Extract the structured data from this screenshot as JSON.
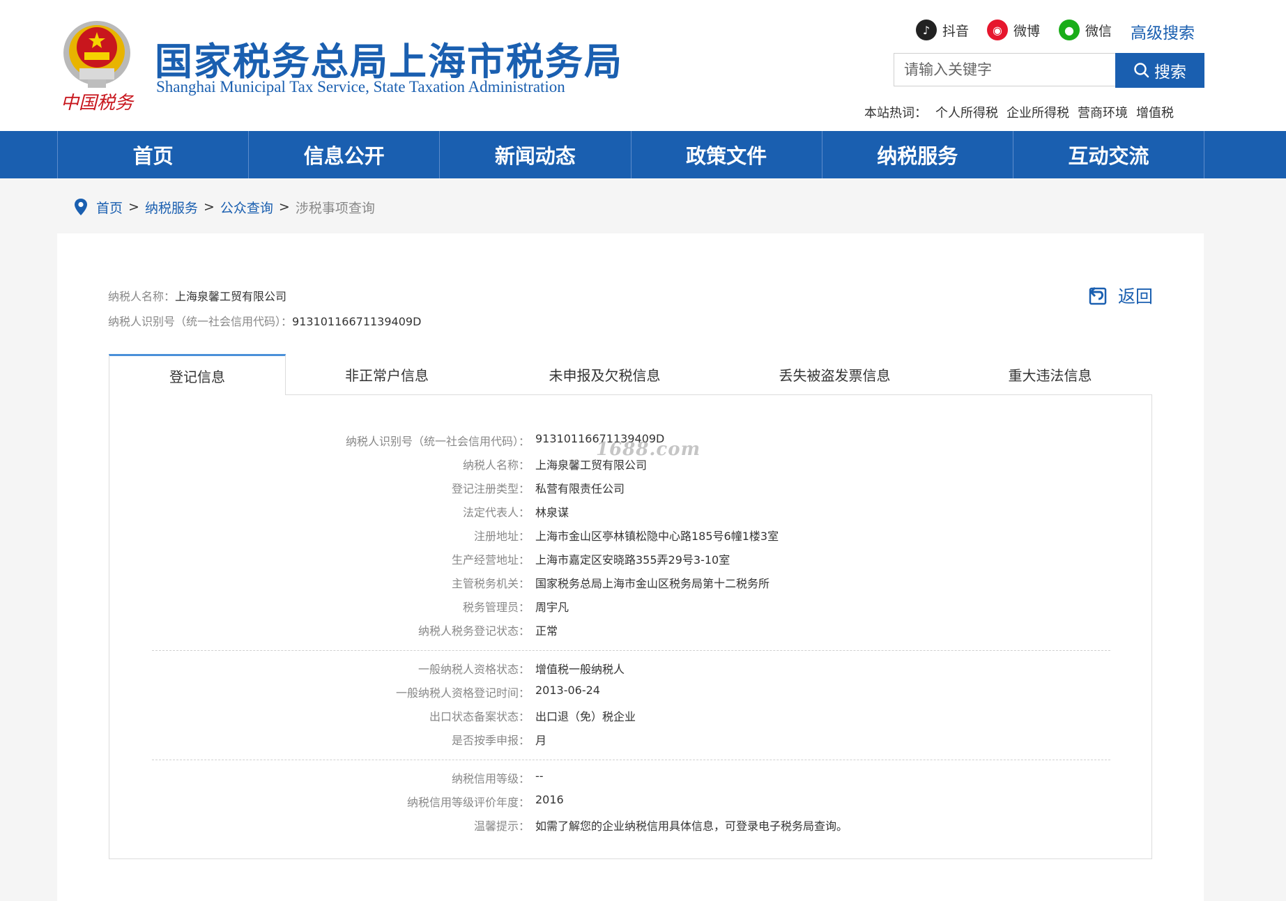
{
  "header": {
    "title_cn": "国家税务总局上海市税务局",
    "title_en": "Shanghai Municipal Tax Service, State Taxation Administration",
    "emblem_caption": "中国税务",
    "social": [
      {
        "name": "douyin",
        "label": "抖音",
        "icon": "douyin-icon",
        "color": "#222222"
      },
      {
        "name": "weibo",
        "label": "微博",
        "icon": "weibo-icon",
        "color": "#e6162d"
      },
      {
        "name": "wechat",
        "label": "微信",
        "icon": "wechat-icon",
        "color": "#1aad19"
      }
    ],
    "advanced_search": "高级搜索",
    "search": {
      "placeholder": "请输入关键字",
      "value": "",
      "button": "搜索"
    },
    "hot": {
      "label": "本站热词：",
      "items": [
        "个人所得税",
        "企业所得税",
        "营商环境",
        "增值税"
      ]
    }
  },
  "nav": [
    "首页",
    "信息公开",
    "新闻动态",
    "政策文件",
    "纳税服务",
    "互动交流"
  ],
  "breadcrumb": {
    "items": [
      "首页",
      "纳税服务",
      "公众查询"
    ],
    "current": "涉税事项查询",
    "sep": ">"
  },
  "taxpayer": {
    "name_label": "纳税人名称：",
    "name": "上海泉馨工贸有限公司",
    "id_label": "纳税人识别号（统一社会信用代码）：",
    "id": "91310116671139409D"
  },
  "back_label": "返回",
  "tabs": [
    "登记信息",
    "非正常户信息",
    "未申报及欠税信息",
    "丢失被盗发票信息",
    "重大违法信息"
  ],
  "details": {
    "group1": [
      {
        "k": "纳税人识别号（统一社会信用代码）：",
        "v": "91310116671139409D"
      },
      {
        "k": "纳税人名称：",
        "v": "上海泉馨工贸有限公司"
      },
      {
        "k": "登记注册类型：",
        "v": "私营有限责任公司"
      },
      {
        "k": "法定代表人：",
        "v": "林泉谋"
      },
      {
        "k": "注册地址：",
        "v": "上海市金山区亭林镇松隐中心路185号6幢1楼3室"
      },
      {
        "k": "生产经营地址：",
        "v": "上海市嘉定区安晓路355弄29号3-10室"
      },
      {
        "k": "主管税务机关：",
        "v": "国家税务总局上海市金山区税务局第十二税务所"
      },
      {
        "k": "税务管理员：",
        "v": "周宇凡"
      },
      {
        "k": "纳税人税务登记状态：",
        "v": "正常"
      }
    ],
    "group2": [
      {
        "k": "一般纳税人资格状态：",
        "v": "增值税一般纳税人"
      },
      {
        "k": "一般纳税人资格登记时间：",
        "v": "2013-06-24"
      },
      {
        "k": "出口状态备案状态：",
        "v": "出口退（免）税企业"
      },
      {
        "k": "是否按季申报：",
        "v": "月"
      }
    ],
    "group3": [
      {
        "k": "纳税信用等级：",
        "v": "--"
      },
      {
        "k": "纳税信用等级评价年度：",
        "v": "2016"
      },
      {
        "k": "温馨提示：",
        "v": "如需了解您的企业纳税信用具体信息，可登录电子税务局查询。"
      }
    ]
  },
  "watermark": "1688.com",
  "colors": {
    "brand": "#1a5fb0",
    "tab_accent": "#4a90d9",
    "emblem_red": "#c8161d",
    "emblem_gold": "#e8b400"
  }
}
